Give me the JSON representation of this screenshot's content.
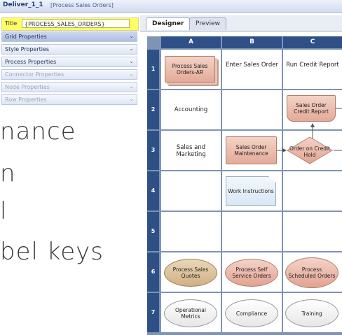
{
  "window": {
    "title": "Deliver_1_1",
    "subtitle": "[Process Sales Orders]"
  },
  "left_panel": {
    "title_label": "Title",
    "title_value": "{PROCESS_SALES_ORDERS}",
    "properties": [
      {
        "label": "Grid Properties",
        "enabled": true,
        "selected": true
      },
      {
        "label": "Style Properties",
        "enabled": true
      },
      {
        "label": "Process Properties",
        "enabled": true
      },
      {
        "label": "Connector Properties",
        "enabled": false
      },
      {
        "label": "Node Properties",
        "enabled": false
      },
      {
        "label": "Row Properties",
        "enabled": false
      }
    ]
  },
  "overlay_text": [
    "nance",
    "n",
    "l",
    "bel keys"
  ],
  "tabs": [
    {
      "label": "Designer",
      "active": true
    },
    {
      "label": "Preview",
      "active": false
    }
  ],
  "grid": {
    "columns": [
      "A",
      "B",
      "C"
    ],
    "rows": [
      "1",
      "2",
      "3",
      "4",
      "5",
      "6",
      "7"
    ],
    "cells": {
      "a1": "Process Sales Orders-AR",
      "b1": "Enter Sales Order",
      "c1": "Run Credit Report",
      "a2": "Accounting",
      "c2": "Sales Order Credit Report",
      "a3": "Sales and Marketing",
      "b3": "Sales Order Maintenance",
      "c3": "Order on Credit Hold",
      "b4": "Work Instructions",
      "a6": "Process Sales Quotes",
      "b6": "Process Self Service Orders",
      "c6": "Process Scheduled Orders",
      "a7": "Operational Metrics",
      "b7": "Compliance",
      "c7": "Training"
    }
  },
  "colors": {
    "header": "#2f4f87",
    "title_highlight": "#ffff66",
    "process_fill": "#e3aa98"
  }
}
